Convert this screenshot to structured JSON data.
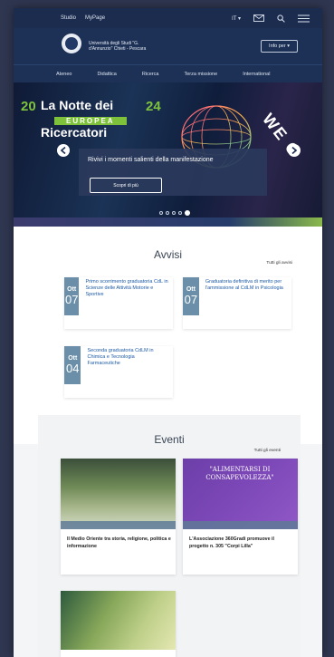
{
  "topbar": {
    "link1": "Studio",
    "link2": "MyPage",
    "lang": "IT",
    "chevron": "▾"
  },
  "header": {
    "university": "Università degli Studi \"G. d'Annunzio\" Chieti - Pescara",
    "info_button": "Info per ▾"
  },
  "nav": {
    "items": [
      "Ateneo",
      "Didattica",
      "Ricerca",
      "Terza missione",
      "International"
    ]
  },
  "hero": {
    "title_line1": "La Notte dei",
    "band": "EUROPEA",
    "title_line2": "Ricercatori",
    "side_left": "20",
    "side_right": "24",
    "rotated": "WE C",
    "caption": "Rivivi i momenti salienti della manifestazione",
    "button": "Scopri di più",
    "slides_total": 5,
    "slide_active": 5
  },
  "avvisi": {
    "title": "Avvisi",
    "all_link": "Tutti gli avvisi",
    "items": [
      {
        "month": "Ott",
        "day": "07",
        "text": "Primo scorrimento graduatoria CdL in Scienze delle Attività Motorie e Sportive"
      },
      {
        "month": "Ott",
        "day": "07",
        "text": "Graduatoria definitiva di merito per l'ammissione al CdLM in Psicologia"
      },
      {
        "month": "Ott",
        "day": "04",
        "text": "Seconda graduatoria CdLM in Chimica e Tecnologia Farmaceutiche"
      }
    ]
  },
  "eventi": {
    "title": "Eventi",
    "all_link": "Tutti gli eventi",
    "items": [
      {
        "text": "Il Medio Oriente tra storia, religione, politica e informazione"
      },
      {
        "poster": "\"ALIMENTARSI DI CONSAPEVOLEZZA\"",
        "text": "L'Associazione 360Gradi promuove il progetto n. 305 \"Corpi Lilla\""
      },
      {
        "text": ""
      }
    ]
  },
  "colors": {
    "navy": "#1d3156",
    "accent_green": "#7ec23c",
    "date_box": "#6b8fa9",
    "link_blue": "#1c5aa6"
  }
}
